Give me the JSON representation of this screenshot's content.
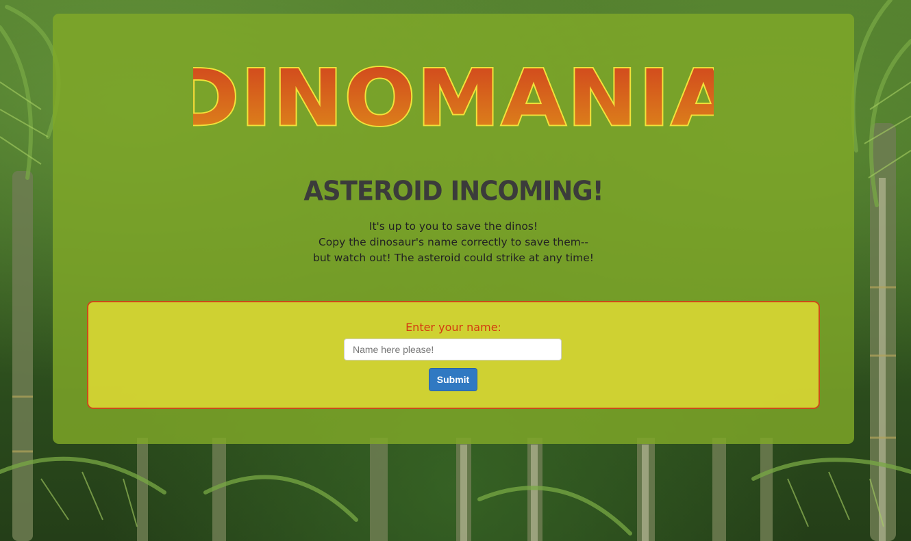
{
  "logo": {
    "text": "DINOMANIA"
  },
  "headline": "ASTEROID INCOMING!",
  "intro": {
    "line1": "It's up to you to save the dinos!",
    "line2": "Copy the dinosaur's name correctly to save them--",
    "line3": "but watch out! The asteroid could strike at any time!"
  },
  "form": {
    "label": "Enter your name:",
    "input_value": "",
    "input_placeholder": "Name here please!",
    "submit_label": "Submit"
  },
  "colors": {
    "panel": "#80a828",
    "form_box": "#dcd834",
    "form_border": "#cc4a1a",
    "label": "#d33a10",
    "button": "#3079c2",
    "logo_fill_top": "#d4471c",
    "logo_fill_bottom": "#dd8a1a",
    "logo_outline": "#f2e23a"
  }
}
